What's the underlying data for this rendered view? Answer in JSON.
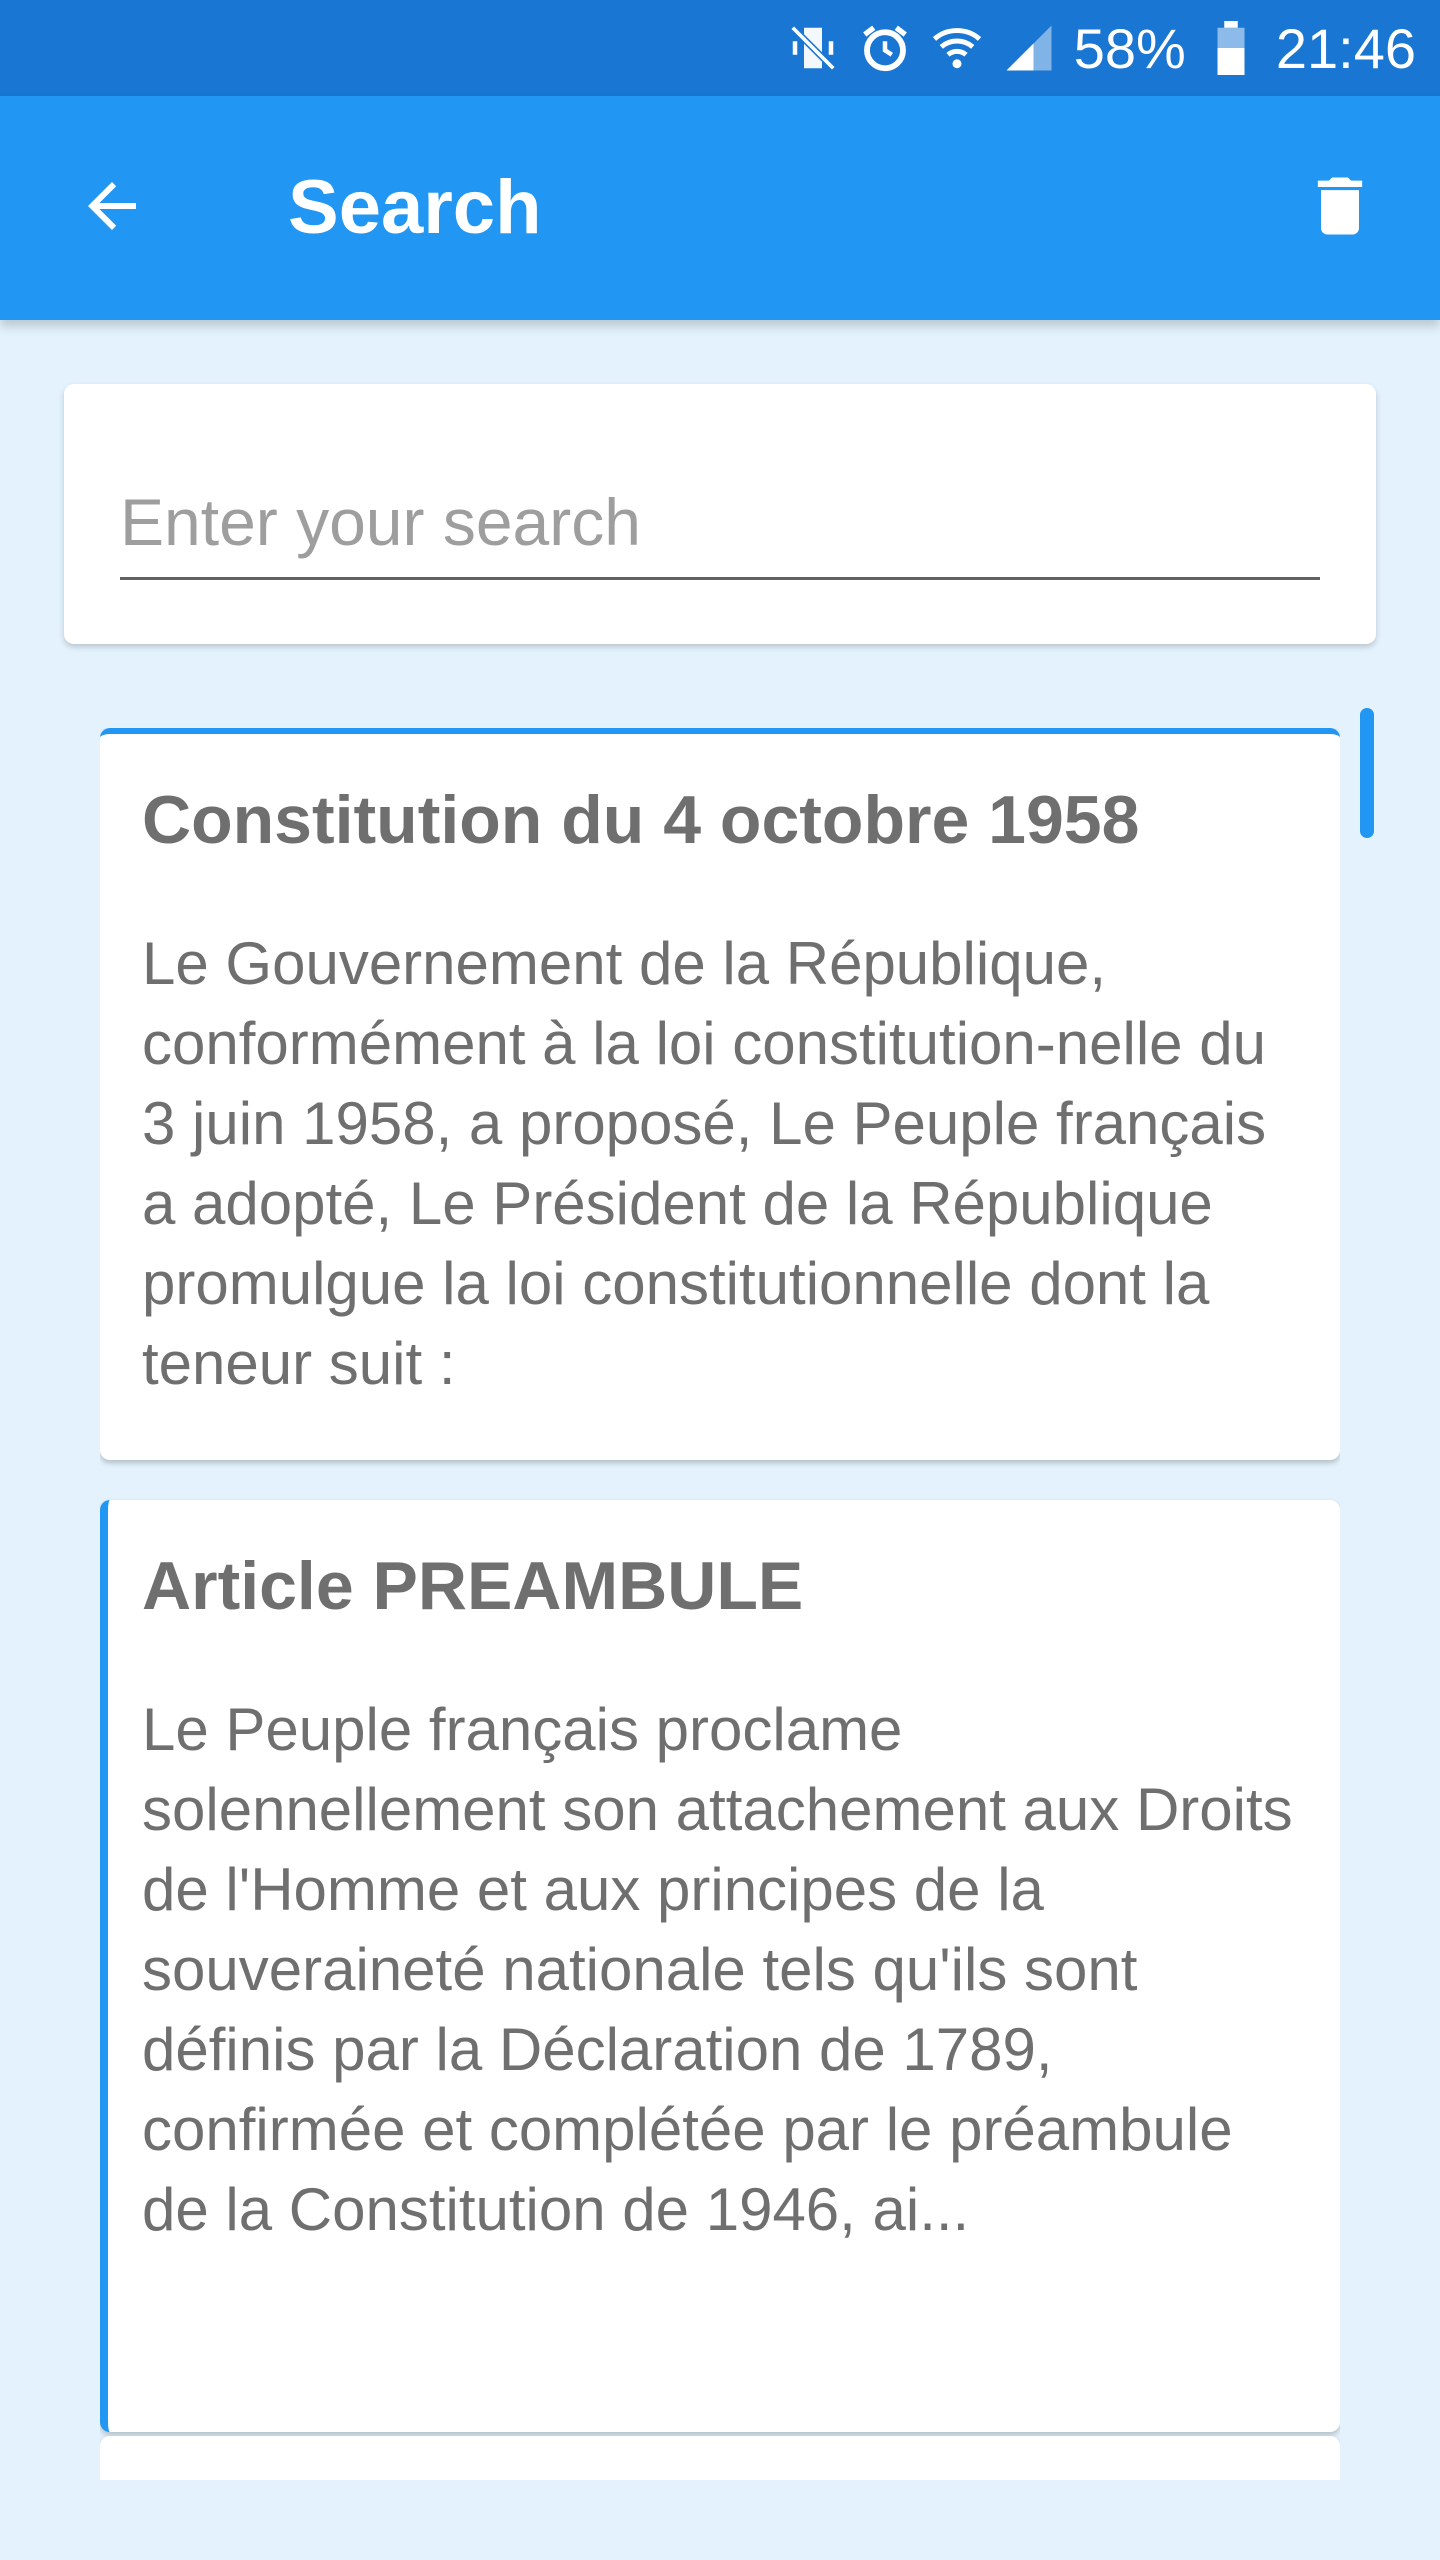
{
  "status_bar": {
    "battery_percent": "58%",
    "time": "21:46",
    "icons": [
      "mute-vibrate-icon",
      "alarm-icon",
      "wifi-icon",
      "signal-icon",
      "battery-icon"
    ]
  },
  "app_bar": {
    "title": "Search",
    "back_icon": "arrow-left-icon",
    "delete_icon": "trash-icon",
    "color": "#2196F3"
  },
  "search": {
    "placeholder": "Enter your search",
    "value": ""
  },
  "results": [
    {
      "title": "Constitution du 4 octobre 1958",
      "body": "Le Gouvernement de la République, conformément à la loi constitution-nelle du 3 juin 1958, a proposé, Le Peuple français a adopté, Le Président de la République promulgue la loi constitutionnelle dont la teneur suit :"
    },
    {
      "title": "Article PREAMBULE",
      "body": "Le Peuple français proclame solennellement son attachement aux Droits de l'Homme et aux principes de la souveraineté nationale tels qu'ils sont définis par la Déclaration de 1789, confirmée et complétée par le préambule de la Constitution de 1946, ai..."
    }
  ]
}
